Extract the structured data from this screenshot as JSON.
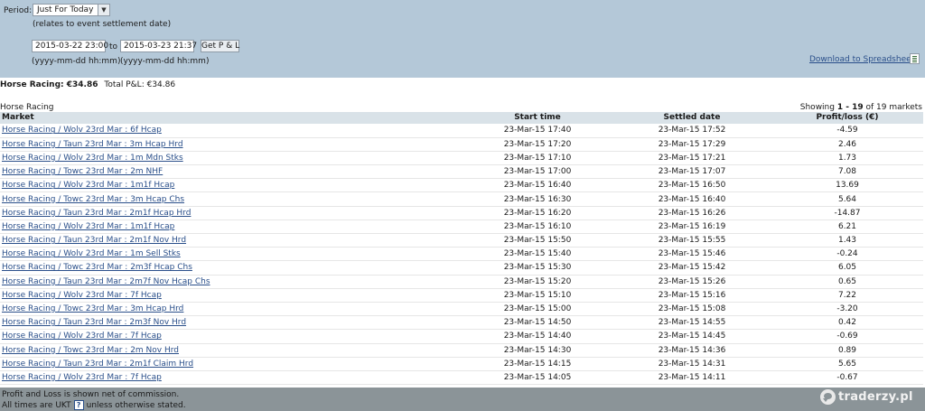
{
  "filters": {
    "period_label": "Period:",
    "period_value": "Just For Today",
    "relates_note": "(relates to event settlement date)",
    "from_value": "2015-03-22 23:00",
    "to_label": "to",
    "to_value": "2015-03-23 21:37",
    "get_pl_label": "Get P & L",
    "format_hint_from": "(yyyy-mm-dd hh:mm)",
    "format_hint_to": "(yyyy-mm-dd hh:mm)",
    "download_label": "Download to Spreadsheet"
  },
  "totals": {
    "sport_total": "Horse Racing: €34.86",
    "total_pl": "Total P&L:  €34.86"
  },
  "section": {
    "title": "Horse Racing",
    "showing_prefix": "Showing",
    "showing_range": "1 - 19",
    "showing_suffix": "of 19 markets"
  },
  "table": {
    "headers": {
      "market": "Market",
      "start": "Start time",
      "settled": "Settled date",
      "pl": "Profit/loss (€)"
    },
    "rows": [
      {
        "market": "Horse Racing / Wolv 23rd Mar : 6f Hcap",
        "start": "23-Mar-15 17:40",
        "settled": "23-Mar-15 17:52",
        "pl": "-4.59"
      },
      {
        "market": "Horse Racing / Taun 23rd Mar : 3m Hcap Hrd",
        "start": "23-Mar-15 17:20",
        "settled": "23-Mar-15 17:29",
        "pl": "2.46"
      },
      {
        "market": "Horse Racing / Wolv 23rd Mar : 1m Mdn Stks",
        "start": "23-Mar-15 17:10",
        "settled": "23-Mar-15 17:21",
        "pl": "1.73"
      },
      {
        "market": "Horse Racing / Towc 23rd Mar : 2m NHF",
        "start": "23-Mar-15 17:00",
        "settled": "23-Mar-15 17:07",
        "pl": "7.08"
      },
      {
        "market": "Horse Racing / Wolv 23rd Mar : 1m1f Hcap",
        "start": "23-Mar-15 16:40",
        "settled": "23-Mar-15 16:50",
        "pl": "13.69"
      },
      {
        "market": "Horse Racing / Towc 23rd Mar : 3m Hcap Chs",
        "start": "23-Mar-15 16:30",
        "settled": "23-Mar-15 16:40",
        "pl": "5.64"
      },
      {
        "market": "Horse Racing / Taun 23rd Mar : 2m1f Hcap Hrd",
        "start": "23-Mar-15 16:20",
        "settled": "23-Mar-15 16:26",
        "pl": "-14.87"
      },
      {
        "market": "Horse Racing / Wolv 23rd Mar : 1m1f Hcap",
        "start": "23-Mar-15 16:10",
        "settled": "23-Mar-15 16:19",
        "pl": "6.21"
      },
      {
        "market": "Horse Racing / Taun 23rd Mar : 2m1f Nov Hrd",
        "start": "23-Mar-15 15:50",
        "settled": "23-Mar-15 15:55",
        "pl": "1.43"
      },
      {
        "market": "Horse Racing / Wolv 23rd Mar : 1m Sell Stks",
        "start": "23-Mar-15 15:40",
        "settled": "23-Mar-15 15:46",
        "pl": "-0.24"
      },
      {
        "market": "Horse Racing / Towc 23rd Mar : 2m3f Hcap Chs",
        "start": "23-Mar-15 15:30",
        "settled": "23-Mar-15 15:42",
        "pl": "6.05"
      },
      {
        "market": "Horse Racing / Taun 23rd Mar : 2m7f Nov Hcap Chs",
        "start": "23-Mar-15 15:20",
        "settled": "23-Mar-15 15:26",
        "pl": "0.65"
      },
      {
        "market": "Horse Racing / Wolv 23rd Mar : 7f Hcap",
        "start": "23-Mar-15 15:10",
        "settled": "23-Mar-15 15:16",
        "pl": "7.22"
      },
      {
        "market": "Horse Racing / Towc 23rd Mar : 3m Hcap Hrd",
        "start": "23-Mar-15 15:00",
        "settled": "23-Mar-15 15:08",
        "pl": "-3.20"
      },
      {
        "market": "Horse Racing / Taun 23rd Mar : 2m3f Nov Hrd",
        "start": "23-Mar-15 14:50",
        "settled": "23-Mar-15 14:55",
        "pl": "0.42"
      },
      {
        "market": "Horse Racing / Wolv 23rd Mar : 7f Hcap",
        "start": "23-Mar-15 14:40",
        "settled": "23-Mar-15 14:45",
        "pl": "-0.69"
      },
      {
        "market": "Horse Racing / Towc 23rd Mar : 2m Nov Hrd",
        "start": "23-Mar-15 14:30",
        "settled": "23-Mar-15 14:36",
        "pl": "0.89"
      },
      {
        "market": "Horse Racing / Taun 23rd Mar : 2m1f Claim Hrd",
        "start": "23-Mar-15 14:15",
        "settled": "23-Mar-15 14:31",
        "pl": "5.65"
      },
      {
        "market": "Horse Racing / Wolv 23rd Mar : 7f Hcap",
        "start": "23-Mar-15 14:05",
        "settled": "23-Mar-15 14:11",
        "pl": "-0.67"
      }
    ]
  },
  "footer": {
    "net_note": "Profit and Loss is shown net of commission.",
    "times_prefix": "All times are UKT",
    "help_glyph": "?",
    "times_suffix": "unless otherwise stated.",
    "watermark": "traderzy.pl"
  }
}
